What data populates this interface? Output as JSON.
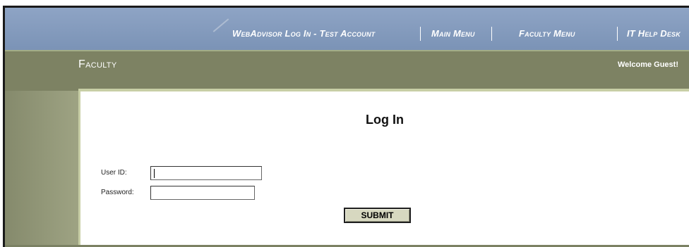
{
  "topnav": {
    "items": [
      "WebAdvisor Log In - Test Account",
      "Main Menu",
      "Faculty Menu",
      "IT Help Desk"
    ]
  },
  "band": {
    "title": "Faculty",
    "welcome": "Welcome Guest!"
  },
  "login": {
    "title": "Log In",
    "user_id_label": "User ID:",
    "user_id_value": "",
    "password_label": "Password:",
    "password_value": "",
    "submit_label": "SUBMIT"
  },
  "colors": {
    "nav_blue": "#7b93b6",
    "olive": "#7d8263",
    "button": "#d7d8c0"
  }
}
